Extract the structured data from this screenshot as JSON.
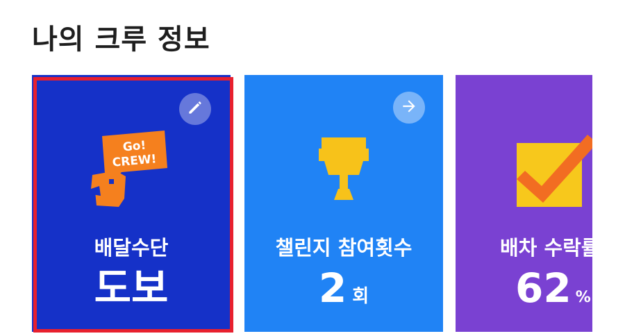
{
  "page_title": "나의 크루 정보",
  "cards": [
    {
      "label": "배달수단",
      "value": "도보",
      "unit": "",
      "action_icon": "pencil-icon",
      "art_icon": "go-crew-mascot-icon",
      "art_text_line1": "Go!",
      "art_text_line2": "CREW!",
      "color": "#1531c8",
      "selected": true
    },
    {
      "label": "챌린지 참여횟수",
      "value": "2",
      "unit": "회",
      "action_icon": "arrow-right-icon",
      "art_icon": "trophy-icon",
      "color": "#2083f5"
    },
    {
      "label": "배차 수락률",
      "value": "62",
      "unit": "%",
      "art_icon": "checkbox-icon",
      "color": "#7a41d2"
    }
  ],
  "colors": {
    "selection_border": "#e8202e",
    "mascot_orange": "#f5801e",
    "trophy_yellow": "#f7c21a",
    "check_yellow": "#f7c81c",
    "check_orange": "#f26d22"
  }
}
